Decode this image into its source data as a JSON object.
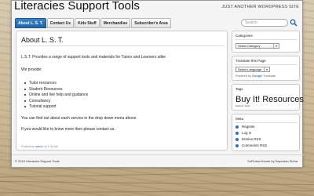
{
  "header": {
    "site_title": "Literacies Support Tools",
    "tagline": "JUST ANOTHER WORDPRESS SITE"
  },
  "nav": {
    "tabs": [
      {
        "label": "About L. S. T.",
        "active": true
      },
      {
        "label": "Contact Us"
      },
      {
        "label": "Kids Stuff"
      },
      {
        "label": "Merchandise"
      },
      {
        "label": "Subscriber's Area"
      }
    ]
  },
  "search": {
    "placeholder": "Search"
  },
  "post": {
    "title": "About L. S. T.",
    "intro": "L.S.T. Provides a range of support tools and materials for Tutors and Learners alike",
    "we_provide": "We provide:",
    "services": [
      "Tutor resources",
      "Student Resources",
      "Online and live help and guidance",
      "Consultancy",
      "Tutorial support"
    ],
    "dropdown_note": "You can find out about each service in the drop down menu above.",
    "contact_note": "If you would like to know more then please contact us.",
    "meta_prefix": "Posted by",
    "meta_author": "admin",
    "meta_suffix": "at 1:34 am"
  },
  "sidebar": {
    "categories": {
      "title": "Categories",
      "select_value": "Select Category"
    },
    "translate": {
      "title": "Translate this Page",
      "select_value": "Select Language",
      "powered_prefix": "Powered by",
      "powered_brand": "Google",
      "powered_suffix": "Translate"
    },
    "tags": {
      "title": "Tags",
      "big_tag": "Buy It! Resources",
      "small_tag": "Support Tools"
    },
    "meta": {
      "title": "Meta",
      "items": [
        "Register",
        "Log in",
        "Entries RSS",
        "Comments RSS"
      ]
    }
  },
  "footer": {
    "left": "© 2010 Literacies Support Tools",
    "right": "SoFlution theme by Sayontan Sinha"
  },
  "colors": {
    "accent": "#2f6fb3",
    "active_tab": "#2a78bd",
    "page_bg": "#f4f4f4"
  }
}
